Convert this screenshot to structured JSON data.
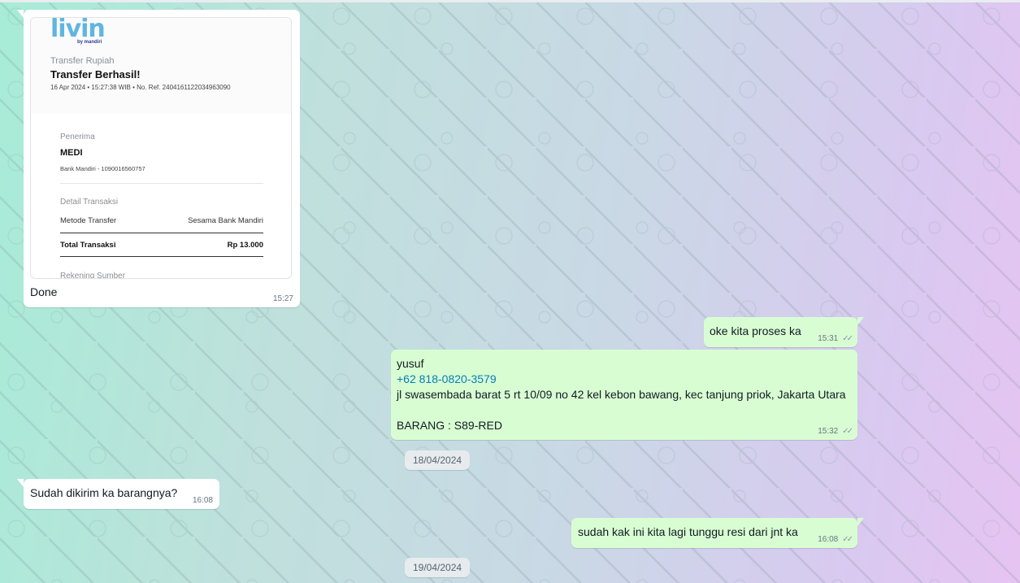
{
  "receipt": {
    "logo_text": "livin",
    "logo_sub": "by mandiri",
    "kind": "Transfer Rupiah",
    "title": "Transfer Berhasil!",
    "meta": "16 Apr 2024 • 15:27:38 WIB • No. Ref. 2404161122034963090",
    "recipient_label": "Penerima",
    "recipient_name": "MEDI",
    "recipient_account": "Bank Mandiri - 1090016560757",
    "detail_label": "Detail Transaksi",
    "method_label": "Metode Transfer",
    "method_value": "Sesama Bank Mandiri",
    "total_label": "Total Transaksi",
    "total_value": "Rp 13.000",
    "source_label": "Rekening Sumber"
  },
  "messages": [
    {
      "text": "Done",
      "time": "15:27"
    },
    {
      "text": "oke kita proses ka",
      "time": "15:31"
    },
    {
      "name": "yusuf",
      "phone": "+62 818-0820-3579",
      "address": "jl swasembada barat 5 rt 10/09 no 42 kel kebon bawang, kec tanjung priok, Jakarta Utara",
      "item": "BARANG : S89-RED",
      "time": "15:32"
    },
    {
      "text": "Sudah dikirim ka barangnya?",
      "time": "16:08"
    },
    {
      "text": "sudah kak ini kita lagi tunggu resi dari jnt ka",
      "time": "16:08"
    }
  ],
  "dates": [
    "18/04/2024",
    "19/04/2024"
  ],
  "icons": {
    "read_ticks": "double-check-icon"
  }
}
